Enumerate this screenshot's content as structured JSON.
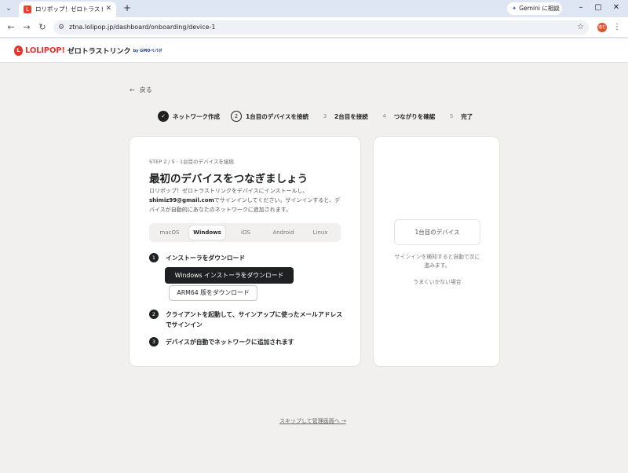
{
  "browser": {
    "tab_title": "ロリポップ！ゼロトラストリンク byGMO",
    "gemini_label": "Gemini に相談",
    "url": "ztna.lolipop.jp/dashboard/onboarding/device-1",
    "avatar_label": "進む"
  },
  "header": {
    "brand_name": "LOLIPOP!",
    "brand_product": "ゼロトラストリンク",
    "brand_by": "by GMOペパボ"
  },
  "nav": {
    "back_label": "戻る"
  },
  "stepper": [
    {
      "num": "✓",
      "label": "ネットワーク作成",
      "state": "done"
    },
    {
      "num": "2",
      "label": "1台目のデバイスを接続",
      "state": "current"
    },
    {
      "num": "3",
      "label": "2台目を接続",
      "state": "todo"
    },
    {
      "num": "4",
      "label": "つながりを確認",
      "state": "todo"
    },
    {
      "num": "5",
      "label": "完了",
      "state": "todo"
    }
  ],
  "main": {
    "step_meta": "STEP 2 / 5 · 1台目のデバイスを接続",
    "title": "最初のデバイスをつなぎましょう",
    "desc_prefix": "ロリポップ！ゼロトラストリンクをデバイスにインストールし、",
    "desc_email": "shimiz99@gmail.com",
    "desc_suffix": "でサインインしてください。サインインすると、デバイスが自動的にあなたのネットワークに追加されます。",
    "os_tabs": [
      {
        "label": "macOS",
        "active": false
      },
      {
        "label": "Windows",
        "active": true
      },
      {
        "label": "iOS",
        "active": false
      },
      {
        "label": "Android",
        "active": false
      },
      {
        "label": "Linux",
        "active": false
      }
    ],
    "steps": [
      {
        "num": "1",
        "text": "インストーラをダウンロード"
      },
      {
        "num": "2",
        "text": "クライアントを起動して、サインアップに使ったメールアドレスでサインイン"
      },
      {
        "num": "3",
        "text": "デバイスが自動でネットワークに追加されます"
      }
    ],
    "download_primary": "Windows インストーラをダウンロード",
    "download_secondary": "ARM64 版をダウンロード"
  },
  "side": {
    "device_label": "1台目のデバイス",
    "hint": "サインインを検知すると自動で次に進みます。",
    "help_link": "うまくいかない場合"
  },
  "footer": {
    "skip_link": "スキップして管理画面へ →"
  }
}
